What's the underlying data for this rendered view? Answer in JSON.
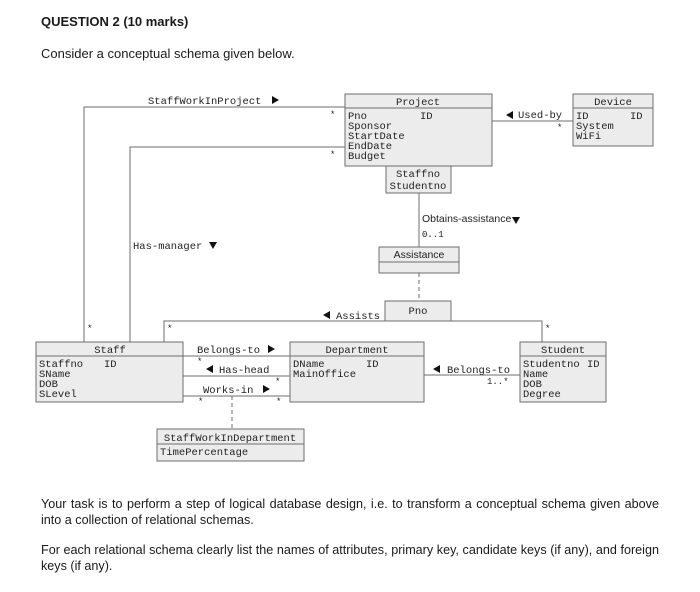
{
  "header": {
    "question_title": "QUESTION 2 (10 marks)",
    "intro": "Consider a conceptual schema given below."
  },
  "diagram": {
    "classes": {
      "project": {
        "name": "Project",
        "attributes": [
          "Pno",
          "Sponsor",
          "StartDate",
          "EndDate",
          "Budget"
        ],
        "id_label": "ID"
      },
      "device": {
        "name": "Device",
        "attributes": [
          "ID",
          "System",
          "WiFi"
        ],
        "id_label": "ID"
      },
      "staff": {
        "name": "Staff",
        "attributes": [
          "Staffno",
          "SName",
          "DOB",
          "SLevel"
        ],
        "id_label": "ID"
      },
      "department": {
        "name": "Department",
        "attributes": [
          "DName",
          "MainOffice"
        ],
        "id_label": "ID"
      },
      "student": {
        "name": "Student",
        "attributes": [
          "Studentno",
          "Name",
          "DOB",
          "Degree"
        ],
        "id_label": "ID"
      },
      "assistance": {
        "name": "Assistance",
        "attributes": []
      },
      "staff_work_in_department": {
        "name": "StaffWorkInDepartment",
        "attributes": [
          "TimePercentage"
        ]
      }
    },
    "qualifiers": {
      "project_qualifier": [
        "Staffno",
        "Studentno"
      ],
      "assists_qualifier": [
        "Pno"
      ]
    },
    "associations": {
      "staff_work_in_project": {
        "label": "StaffWorkInProject",
        "direction": "right",
        "mult_project": "*",
        "mult_staff": "*"
      },
      "has_manager": {
        "label": "Has-manager",
        "direction": "down",
        "mult_project": "*"
      },
      "used_by": {
        "label": "Used-by",
        "direction": "left",
        "mult_device": "*"
      },
      "obtains_assistance": {
        "label": "Obtains-assistance",
        "direction": "down",
        "mult": "0..1"
      },
      "assists": {
        "label": "Assists",
        "direction": "left",
        "mult_staff": "*",
        "mult_student": "*"
      },
      "belongs_to_staff": {
        "label": "Belongs-to",
        "direction": "right",
        "mult": "*"
      },
      "has_head": {
        "label": "Has-head",
        "direction": "left",
        "mult": "*"
      },
      "works_in": {
        "label": "Works-in",
        "direction": "right",
        "mult_staff": "*",
        "mult_department": "*"
      },
      "belongs_to_student": {
        "label": "Belongs-to",
        "direction": "left",
        "mult": "1..*"
      }
    }
  },
  "task": {
    "paragraph1": "Your task is to perform a step of logical database design, i.e. to transform a conceptual schema given above into a collection of relational schemas.",
    "paragraph2": "For each relational schema clearly list the names of attributes, primary key, candidate keys (if any), and foreign keys (if any)."
  }
}
